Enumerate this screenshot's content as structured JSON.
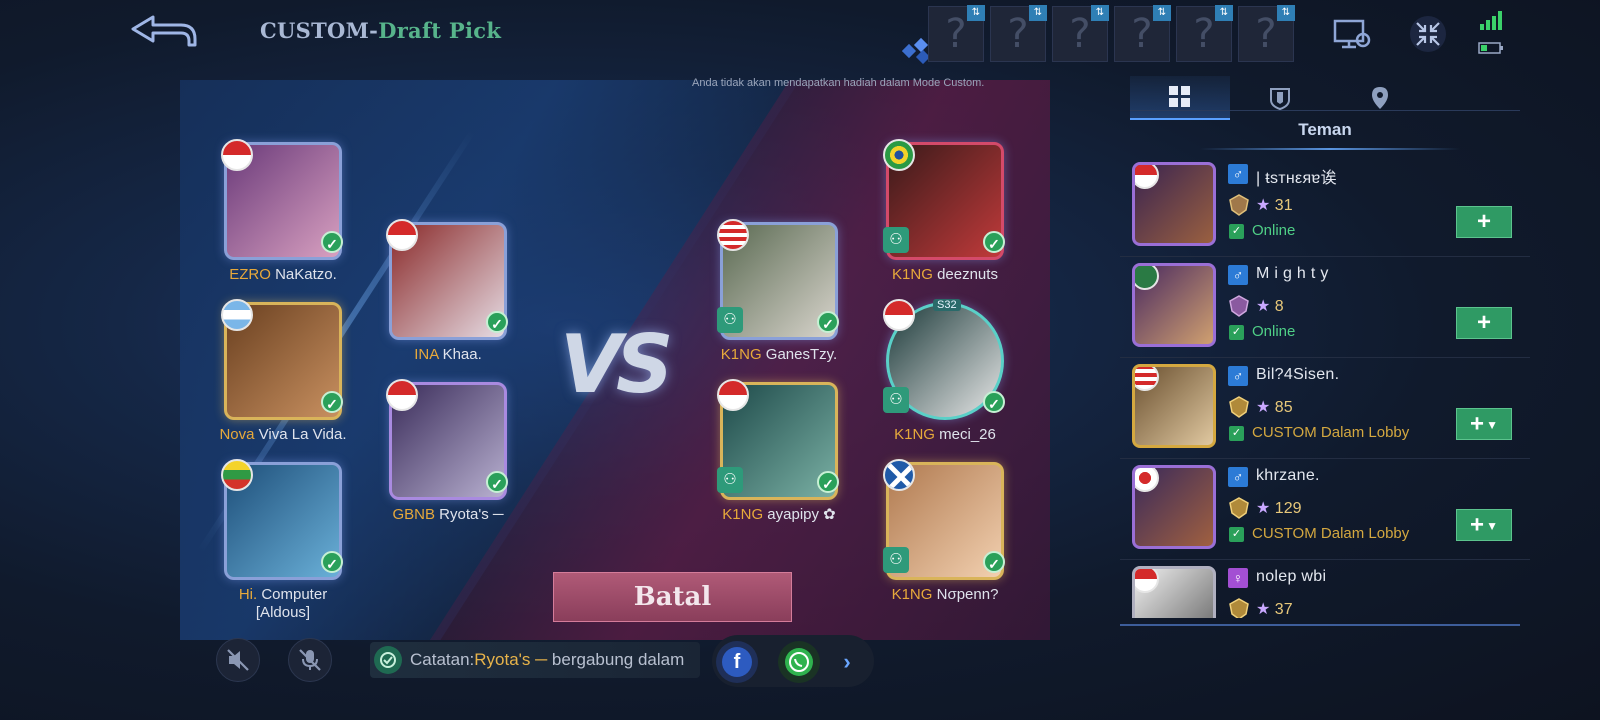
{
  "header": {
    "title_prefix": "CUSTOM-",
    "title_mode": "Draft Pick",
    "notice": "Anda tidak akan mendapatkan hadiah dalam Mode Custom.",
    "ban_slots": [
      "?",
      "?",
      "?",
      "?",
      "?",
      "?"
    ]
  },
  "blue_team": [
    {
      "clan": "EZRO",
      "name": "NaKatzo.",
      "flag": "indonesia"
    },
    {
      "clan": "Nova",
      "name": "Viva La Vida.",
      "flag": "argentina"
    },
    {
      "clan": "Hi.",
      "name": "Computer",
      "name2": "[Aldous]",
      "flag": "myanmar"
    },
    {
      "clan": "INA",
      "name": "Khaa.",
      "flag": "indonesia"
    },
    {
      "clan": "GBNB",
      "name": "Ryota's ─",
      "flag": "indonesia"
    }
  ],
  "red_team": [
    {
      "clan": "K1NG",
      "name": "GanesTzy.",
      "flag": "malaysia"
    },
    {
      "clan": "K1NG",
      "name": "ayapipy ✿",
      "flag": "indonesia"
    },
    {
      "clan": "K1NG",
      "name": "deeznuts",
      "flag": "brazil"
    },
    {
      "clan": "K1NG",
      "name": "meci_26",
      "flag": "indonesia",
      "badge": "S32"
    },
    {
      "clan": "K1NG",
      "name": "Nσpenn?",
      "flag": "scotland"
    }
  ],
  "vs_label": "VS",
  "cancel_label": "Batal",
  "note": {
    "prefix": "Catatan:",
    "highlight": "Ryota's ─",
    "rest": " bergabung dalam"
  },
  "panel": {
    "tabs": [
      "grid-icon",
      "shield-icon",
      "location-icon"
    ],
    "title": "Teman",
    "friends": [
      {
        "name": "| ŧsтнεяɐ诶",
        "gender": "♂",
        "stars": "31",
        "status": "Online",
        "status_type": "online",
        "flag": "indonesia",
        "action": "+"
      },
      {
        "name": "M i g h t y",
        "gender": "♂",
        "stars": "8",
        "status": "Online",
        "status_type": "online",
        "flag": "saudi",
        "action": "+"
      },
      {
        "name": "Bil?4Sisen.",
        "gender": "♂",
        "stars": "85",
        "status": "CUSTOM Dalam Lobby",
        "status_type": "lobby",
        "flag": "malaysia",
        "action": "+"
      },
      {
        "name": "khrzane.",
        "gender": "♂",
        "stars": "129",
        "status": "CUSTOM Dalam Lobby",
        "status_type": "lobby",
        "flag": "japan",
        "action": "+"
      },
      {
        "name": "nolep wbi",
        "gender": "♀",
        "stars": "37",
        "status": "",
        "status_type": "",
        "flag": "indonesia",
        "action": ""
      }
    ]
  },
  "colors": {
    "clan": "#e7a93b",
    "accent_green": "#2f9a64",
    "title_green": "#57b48b",
    "online": "#4fcf86",
    "lobby": "#d4a840"
  }
}
